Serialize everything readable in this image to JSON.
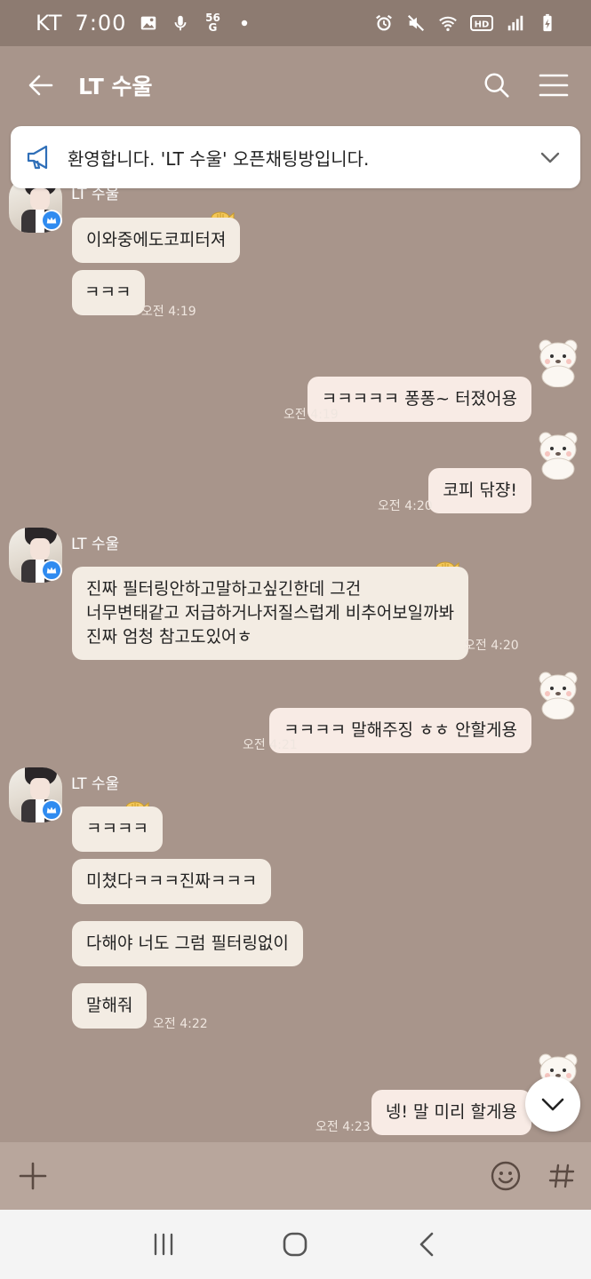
{
  "status_bar": {
    "carrier": "KT",
    "time": "7:00",
    "network_top": "56",
    "network_bottom": "G",
    "hd_label": "HD"
  },
  "header": {
    "title": "LT 수울"
  },
  "notice": {
    "text": "환영합니다. 'LT 수울' 오픈채팅방입니다."
  },
  "messages": {
    "g1_sender": "LT 수울",
    "g1_m1": "이와중에도코피터져",
    "g1_m2": "ㅋㅋㅋ",
    "g1_time": "오전 4:19",
    "o1_text": "ㅋㅋㅋㅋㅋ 퐁퐁~ 터졌어용",
    "o1_time": "오전 4:19",
    "o2_text": "코피 닦쟝!",
    "o2_time": "오전 4:20",
    "g2_sender": "LT 수울",
    "g2_line1": "진짜 필터링안하고말하고싶긴한데 그건",
    "g2_line2": "너무변태같고 저급하거나저질스럽게 비추어보일까봐",
    "g2_line3": "진짜 엄청 참고도있어ㅎ",
    "g2_time": "오전 4:20",
    "o3_text": "ㅋㅋㅋㅋ 말해주징 ㅎㅎ 안할게용",
    "o3_time": "오전 4:21",
    "g3_sender": "LT 수울",
    "g3_m1": "ㅋㅋㅋㅋ",
    "g3_m2": "미쳤다ㅋㅋㅋ진짜ㅋㅋㅋ",
    "g3_m3": "다해야 너도 그럼 필터링없이",
    "g3_m4": "말해줘",
    "g3_time": "오전 4:22",
    "o4_text": "넹! 말 미리 할게용",
    "o4_time": "오전 4:23"
  },
  "icons": {
    "back": "arrow-left-icon",
    "search": "search-icon",
    "menu": "hamburger-menu-icon",
    "notice": "megaphone-icon",
    "expand": "chevron-down-icon",
    "attach": "plus-icon",
    "emoji": "smiley-icon",
    "hashtag": "hashtag-icon"
  },
  "colors": {
    "chat_background": "#a8958b",
    "status_bar": "#8d7b71",
    "incoming_bubble": "#f3ece3",
    "outgoing_bubble": "#f8ebe5",
    "crown_badge": "#2f8bf0"
  }
}
